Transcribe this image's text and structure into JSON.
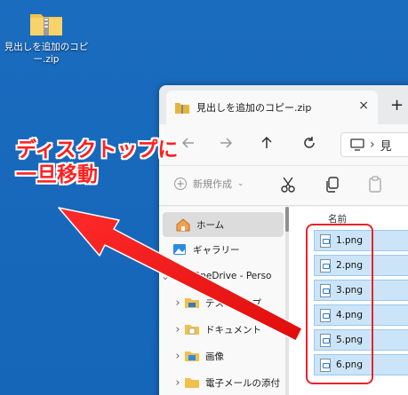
{
  "desktop": {
    "icon_label": "見出しを追加のコピー.zip"
  },
  "annotation": {
    "line1": "ディスクトップに",
    "line2": "一旦移動"
  },
  "window": {
    "tab_title": "見出しを追加のコピー.zip",
    "tab_close": "×",
    "new_tab": "+",
    "address_crumb": "見",
    "new_button_label": "新規作成",
    "column_name": "名前"
  },
  "nav": {
    "items": [
      {
        "label": "ホーム",
        "icon": "home-icon"
      },
      {
        "label": "ギャラリー",
        "icon": "gallery-icon"
      },
      {
        "label": "OneDrive - Perso",
        "icon": "onedrive-icon"
      },
      {
        "label": "デスクトップ",
        "icon": "folder-icon"
      },
      {
        "label": "ドキュメント",
        "icon": "folder-icon"
      },
      {
        "label": "画像",
        "icon": "folder-icon"
      },
      {
        "label": "電子メールの添付",
        "icon": "folder-icon"
      }
    ]
  },
  "files": [
    "1.png",
    "2.png",
    "3.png",
    "4.png",
    "5.png",
    "6.png"
  ],
  "colors": {
    "desktop": "#1565b8",
    "selection": "#cce4f7",
    "annotation_red": "#ff1f1f"
  }
}
